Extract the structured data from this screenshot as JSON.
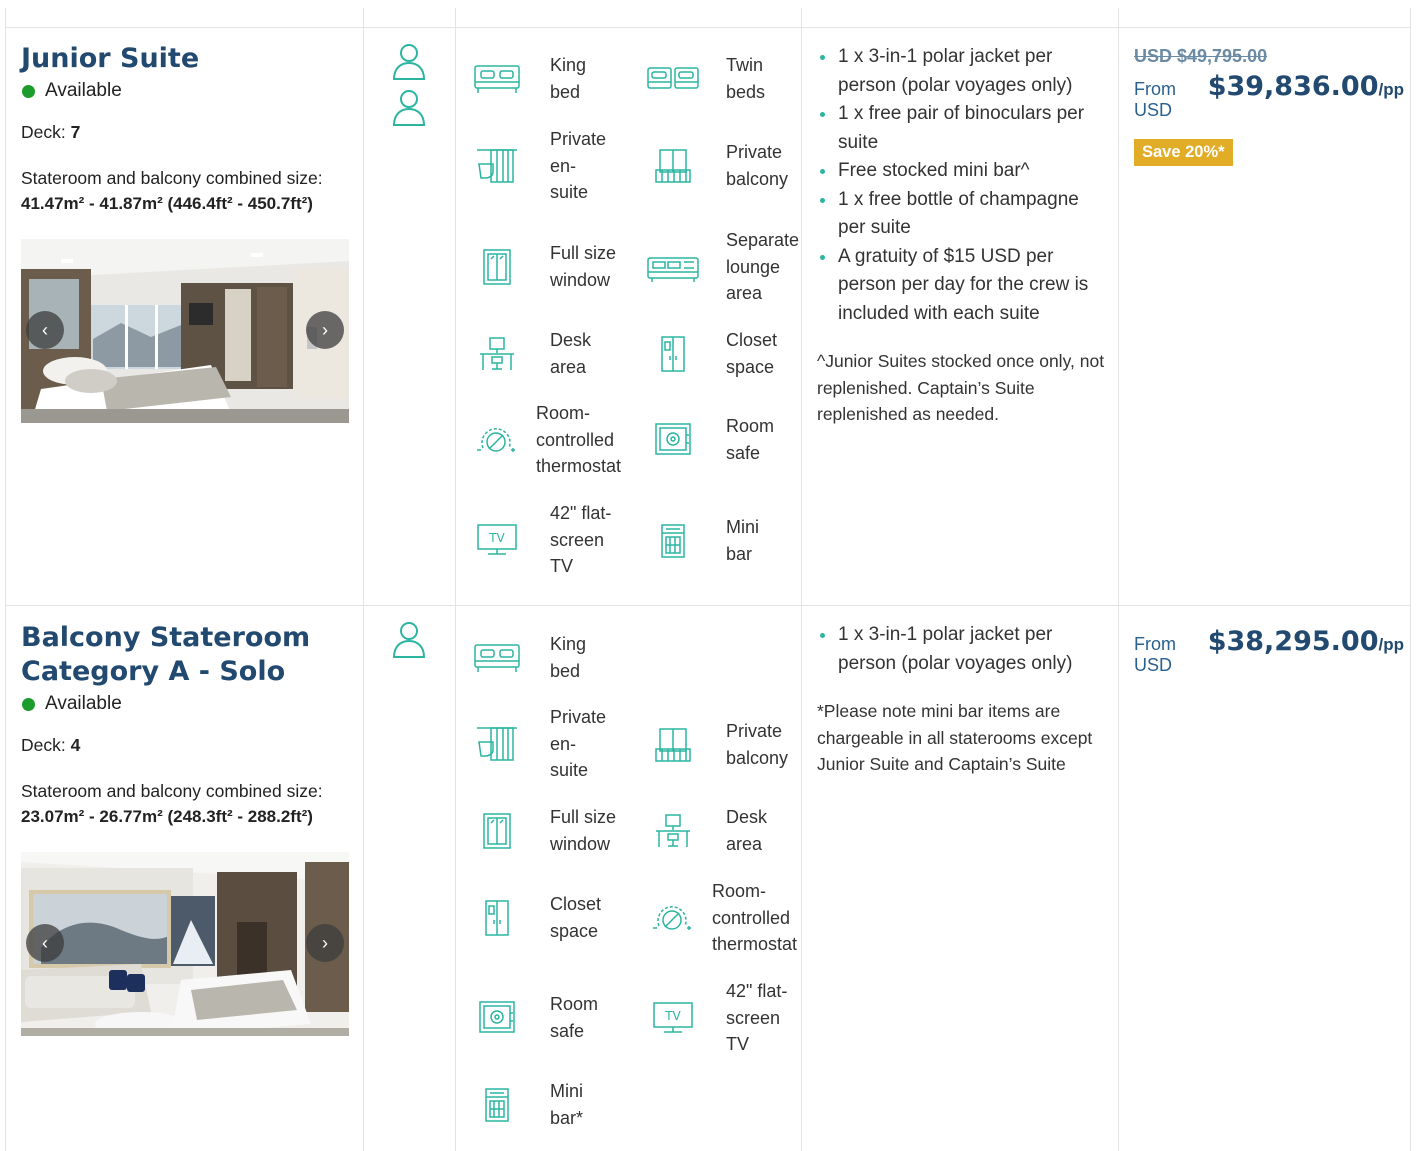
{
  "colors": {
    "title": "#22496f",
    "accent": "#2bb5a0",
    "available": "#1b9c2c",
    "save_badge": "#e1ac26"
  },
  "suites": [
    {
      "title_lines": [
        "Junior Suite"
      ],
      "availability": "Available",
      "deck_label": "Deck:",
      "deck": "7",
      "size_label": "Stateroom and balcony combined size:",
      "size_value": "41.47m² - 41.87m² (446.4ft² - 450.7ft²)",
      "guests": 2,
      "amenities": [
        {
          "icon": "king-bed-icon",
          "lines": [
            "King",
            "bed"
          ]
        },
        {
          "icon": "twin-beds-icon",
          "lines": [
            "Twin",
            "beds"
          ]
        },
        {
          "icon": "private-ensuite-icon",
          "lines": [
            "Private",
            "en-",
            "suite"
          ]
        },
        {
          "icon": "private-balcony-icon",
          "lines": [
            "Private",
            "balcony"
          ]
        },
        {
          "icon": "full-size-window-icon",
          "lines": [
            "Full size",
            "window"
          ]
        },
        {
          "icon": "lounge-area-icon",
          "lines": [
            "Separate",
            "lounge",
            "area"
          ]
        },
        {
          "icon": "desk-area-icon",
          "lines": [
            "Desk",
            "area"
          ]
        },
        {
          "icon": "closet-icon",
          "lines": [
            "Closet",
            "space"
          ]
        },
        {
          "icon": "thermostat-icon",
          "lines": [
            "Room-",
            "controlled",
            "thermostat"
          ]
        },
        {
          "icon": "room-safe-icon",
          "lines": [
            "Room",
            "safe"
          ]
        },
        {
          "icon": "tv-icon",
          "lines": [
            "42\" flat-",
            "screen",
            "TV"
          ]
        },
        {
          "icon": "mini-bar-icon",
          "lines": [
            "Mini",
            "bar"
          ]
        }
      ],
      "perks": [
        "1 x 3-in-1 polar jacket per person (polar voyages only)",
        "1 x free pair of binoculars per suite",
        "Free stocked mini bar^",
        "1 x free bottle of champagne per suite",
        "A gratuity of $15 USD per person per day for the crew is included with each suite"
      ],
      "note": "^Junior Suites stocked once only, not replenished. Captain’s Suite replenished as needed.",
      "old_price": "USD $49,795.00",
      "from_label": "From USD",
      "price": "$39,836.00",
      "per": "/pp",
      "save": "Save 20%*"
    },
    {
      "title_lines": [
        "Balcony Stateroom",
        "Category A - Solo"
      ],
      "availability": "Available",
      "deck_label": "Deck:",
      "deck": "4",
      "size_label": "Stateroom and balcony combined size:",
      "size_value": "23.07m² - 26.77m² (248.3ft² - 288.2ft²)",
      "guests": 1,
      "amenities": [
        {
          "icon": "king-bed-icon",
          "lines": [
            "King",
            "bed"
          ]
        },
        {
          "icon": "private-ensuite-icon",
          "lines": [
            "Private",
            "en-",
            "suite"
          ]
        },
        {
          "icon": "private-balcony-icon",
          "lines": [
            "Private",
            "balcony"
          ]
        },
        {
          "icon": "full-size-window-icon",
          "lines": [
            "Full size",
            "window"
          ]
        },
        {
          "icon": "desk-area-icon",
          "lines": [
            "Desk",
            "area"
          ]
        },
        {
          "icon": "closet-icon",
          "lines": [
            "Closet",
            "space"
          ]
        },
        {
          "icon": "thermostat-icon",
          "lines": [
            "Room-",
            "controlled",
            "thermostat"
          ]
        },
        {
          "icon": "room-safe-icon",
          "lines": [
            "Room",
            "safe"
          ]
        },
        {
          "icon": "tv-icon",
          "lines": [
            "42\" flat-",
            "screen",
            "TV"
          ]
        },
        {
          "icon": "mini-bar-icon",
          "lines": [
            "Mini",
            "bar*"
          ]
        }
      ],
      "perks": [
        "1 x 3-in-1 polar jacket per person (polar voyages only)"
      ],
      "note": "*Please note mini bar items are chargeable in all staterooms except Junior Suite and Captain’s Suite",
      "from_label": "From USD",
      "price": "$38,295.00",
      "per": "/pp"
    }
  ]
}
